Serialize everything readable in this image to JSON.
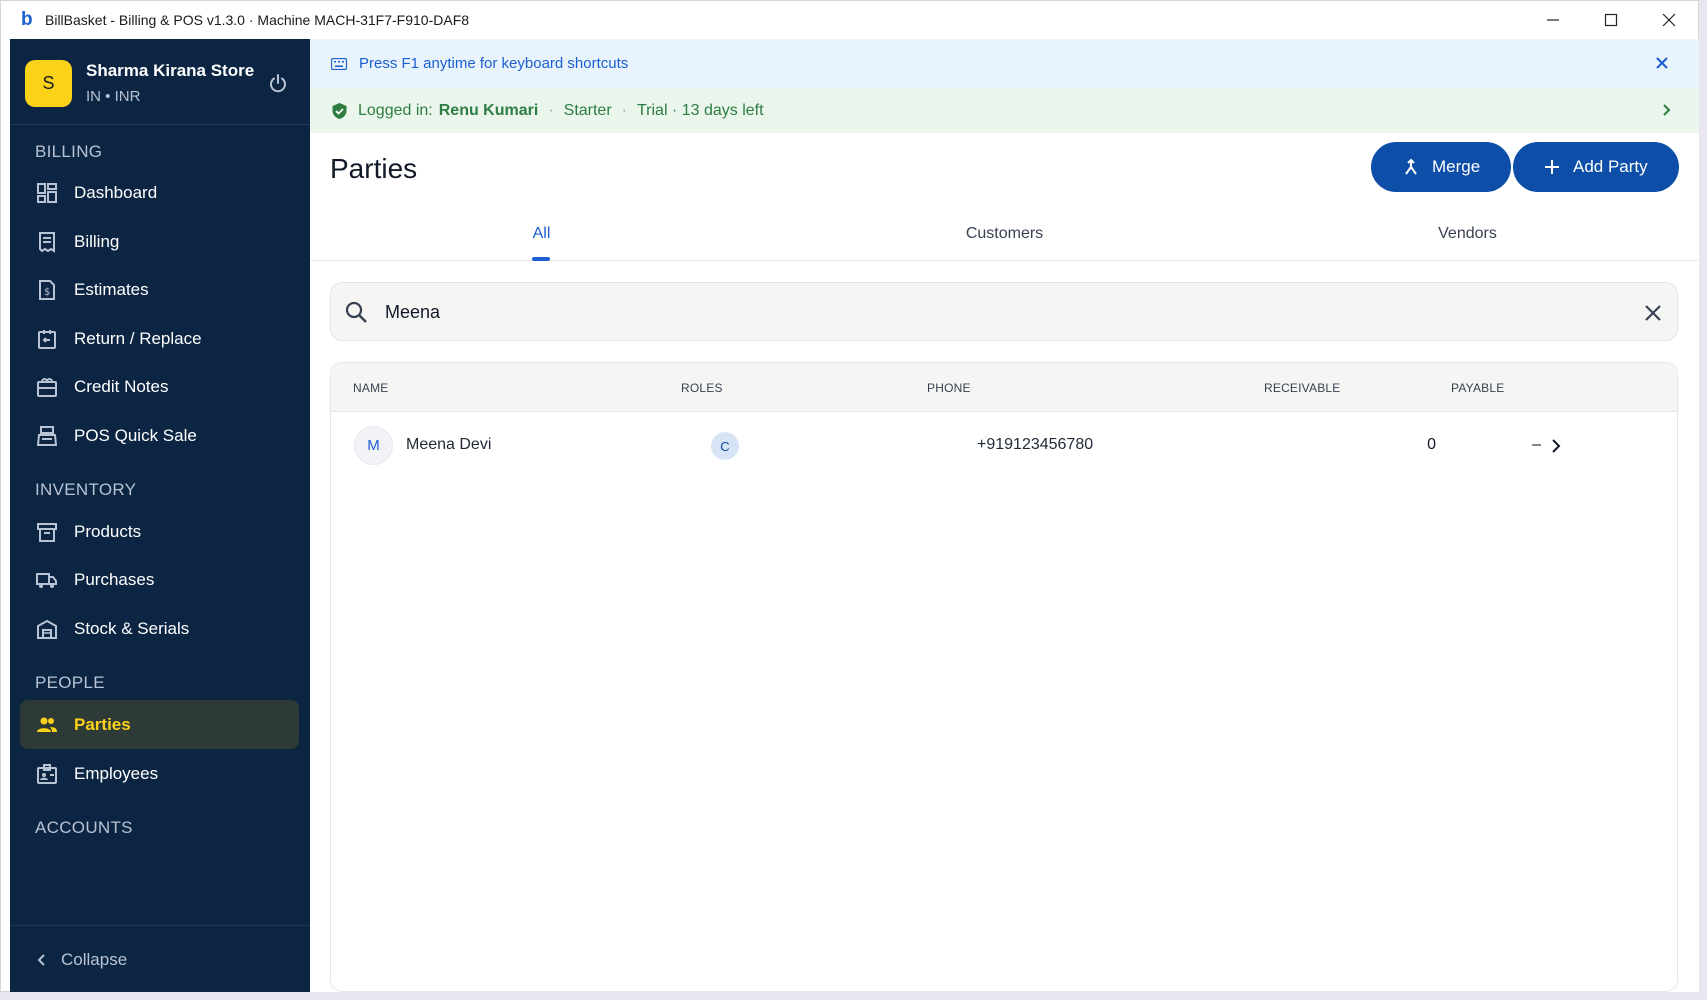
{
  "window": {
    "title": "BillBasket - Billing & POS  v1.3.0  ·  Machine MACH-31F7-F910-DAF8",
    "logo_letter": "b"
  },
  "sidebar": {
    "store": {
      "avatar_letter": "S",
      "name": "Sharma Kirana Store",
      "sub": "IN • INR"
    },
    "sections": {
      "billing": "BILLING",
      "inventory": "INVENTORY",
      "people": "PEOPLE",
      "accounts": "ACCOUNTS"
    },
    "items": [
      {
        "label": "Dashboard",
        "icon": "dashboard-icon"
      },
      {
        "label": "Billing",
        "icon": "receipt-icon"
      },
      {
        "label": "Estimates",
        "icon": "estimate-icon"
      },
      {
        "label": "Return / Replace",
        "icon": "return-icon"
      },
      {
        "label": "Credit Notes",
        "icon": "credit-note-icon"
      },
      {
        "label": "POS Quick Sale",
        "icon": "pos-icon"
      },
      {
        "label": "Products",
        "icon": "box-icon"
      },
      {
        "label": "Purchases",
        "icon": "truck-icon"
      },
      {
        "label": "Stock & Serials",
        "icon": "warehouse-icon"
      },
      {
        "label": "Parties",
        "icon": "people-icon",
        "active": true
      },
      {
        "label": "Employees",
        "icon": "badge-icon"
      }
    ],
    "collapse_label": "Collapse"
  },
  "banners": {
    "shortcuts": "Press F1 anytime for keyboard shortcuts",
    "login_label": "Logged in:",
    "login_user": "Renu Kumari",
    "plan": "Starter",
    "trial": "Trial · 13 days left"
  },
  "page": {
    "title": "Parties",
    "merge_label": "Merge",
    "add_label": "Add Party"
  },
  "tabs": [
    "All",
    "Customers",
    "Vendors"
  ],
  "search": {
    "value": "Meena"
  },
  "table": {
    "headers": [
      "NAME",
      "ROLES",
      "PHONE",
      "RECEIVABLE",
      "PAYABLE"
    ],
    "rows": [
      {
        "avatar": "M",
        "name": "Meena Devi",
        "role": "C",
        "phone": "+919123456780",
        "receivable": "0",
        "payable": "–"
      }
    ]
  },
  "colors": {
    "sidebar_bg": "#0c2543",
    "accent_yellow": "#fcd11a",
    "primary_blue": "#0d4fa8",
    "success_green": "#2e7d43"
  }
}
